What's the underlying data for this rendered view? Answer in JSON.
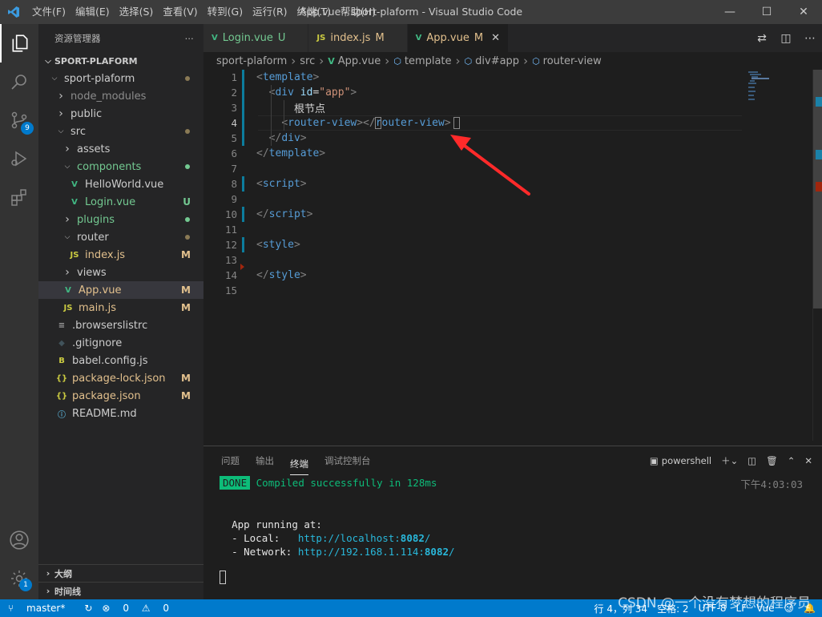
{
  "titlebar": {
    "menu": [
      "文件(F)",
      "编辑(E)",
      "选择(S)",
      "查看(V)",
      "转到(G)",
      "运行(R)",
      "终端(T)",
      "帮助(H)"
    ],
    "title": "App.vue - sport-plaform - Visual Studio Code"
  },
  "activity": {
    "scm_badge": "9",
    "accounts_badge": "1"
  },
  "sidebar": {
    "header": "资源管理器",
    "root": "SPORT-PLAFORM",
    "tree": [
      {
        "label": "sport-plaform",
        "type": "folder",
        "open": true,
        "depth": 0,
        "dot": "mod"
      },
      {
        "label": "node_modules",
        "type": "folder",
        "open": false,
        "depth": 1,
        "dim": true
      },
      {
        "label": "public",
        "type": "folder",
        "open": false,
        "depth": 1
      },
      {
        "label": "src",
        "type": "folder",
        "open": true,
        "depth": 1,
        "dot": "mod"
      },
      {
        "label": "assets",
        "type": "folder",
        "open": false,
        "depth": 2
      },
      {
        "label": "components",
        "type": "folder",
        "open": true,
        "depth": 2,
        "dot": "new",
        "color": "new"
      },
      {
        "label": "HelloWorld.vue",
        "type": "vue",
        "depth": 3
      },
      {
        "label": "Login.vue",
        "type": "vue",
        "depth": 3,
        "status": "U",
        "color": "new"
      },
      {
        "label": "plugins",
        "type": "folder",
        "open": false,
        "depth": 2,
        "dot": "new",
        "color": "new"
      },
      {
        "label": "router",
        "type": "folder",
        "open": true,
        "depth": 2,
        "dot": "mod"
      },
      {
        "label": "index.js",
        "type": "js",
        "depth": 3,
        "status": "M",
        "color": "mod"
      },
      {
        "label": "views",
        "type": "folder",
        "open": false,
        "depth": 2
      },
      {
        "label": "App.vue",
        "type": "vue",
        "depth": 2,
        "status": "M",
        "color": "mod",
        "selected": true
      },
      {
        "label": "main.js",
        "type": "js",
        "depth": 2,
        "status": "M",
        "color": "mod"
      },
      {
        "label": ".browserslistrc",
        "type": "lines",
        "depth": 1
      },
      {
        "label": ".gitignore",
        "type": "diamond",
        "depth": 1
      },
      {
        "label": "babel.config.js",
        "type": "babel",
        "depth": 1
      },
      {
        "label": "package-lock.json",
        "type": "json",
        "depth": 1,
        "status": "M",
        "color": "mod"
      },
      {
        "label": "package.json",
        "type": "json",
        "depth": 1,
        "status": "M",
        "color": "mod"
      },
      {
        "label": "README.md",
        "type": "info",
        "depth": 1
      }
    ],
    "outline": "大纲",
    "timeline": "时间线"
  },
  "tabs": [
    {
      "label": "Login.vue",
      "status": "U",
      "icon": "vue",
      "color": "new"
    },
    {
      "label": "index.js",
      "status": "M",
      "icon": "js",
      "color": "mod"
    },
    {
      "label": "App.vue",
      "status": "M",
      "icon": "vue",
      "color": "mod",
      "active": true
    }
  ],
  "breadcrumb": [
    "sport-plaform",
    "src",
    "App.vue",
    "template",
    "div#app",
    "router-view"
  ],
  "code": {
    "lines": [
      "1",
      "2",
      "3",
      "4",
      "5",
      "6",
      "7",
      "8",
      "9",
      "10",
      "11",
      "12",
      "13",
      "14",
      "15"
    ],
    "l1": "template",
    "l2_tag": "div",
    "l2_attr": "id",
    "l2_val": "\"app\"",
    "l3": "根节点",
    "l4": "router-view",
    "l5": "div",
    "l6": "template",
    "l8": "script",
    "l10": "script",
    "l12": "style",
    "l14": "style"
  },
  "panel": {
    "tabs": [
      "问题",
      "输出",
      "终端",
      "调试控制台"
    ],
    "active_tab": "终端",
    "shell": "powershell",
    "done_badge": "DONE",
    "compiled": "Compiled successfully in 128ms",
    "time": "下午4:03:03",
    "running": "App running at:",
    "local_label": "- Local:   ",
    "local_url_pre": "http://localhost:",
    "local_port": "8082",
    "network_label": "- Network: ",
    "network_url_pre": "http://192.168.1.114:",
    "network_port": "8082"
  },
  "status": {
    "branch": "master*",
    "errors": "0",
    "warnings": "0",
    "position": "行 4，列 34",
    "spaces": "空格: 2",
    "encoding": "UTF-8",
    "eol": "LF",
    "language": "Vue"
  },
  "watermark": "CSDN @一个没有梦想的程序员"
}
